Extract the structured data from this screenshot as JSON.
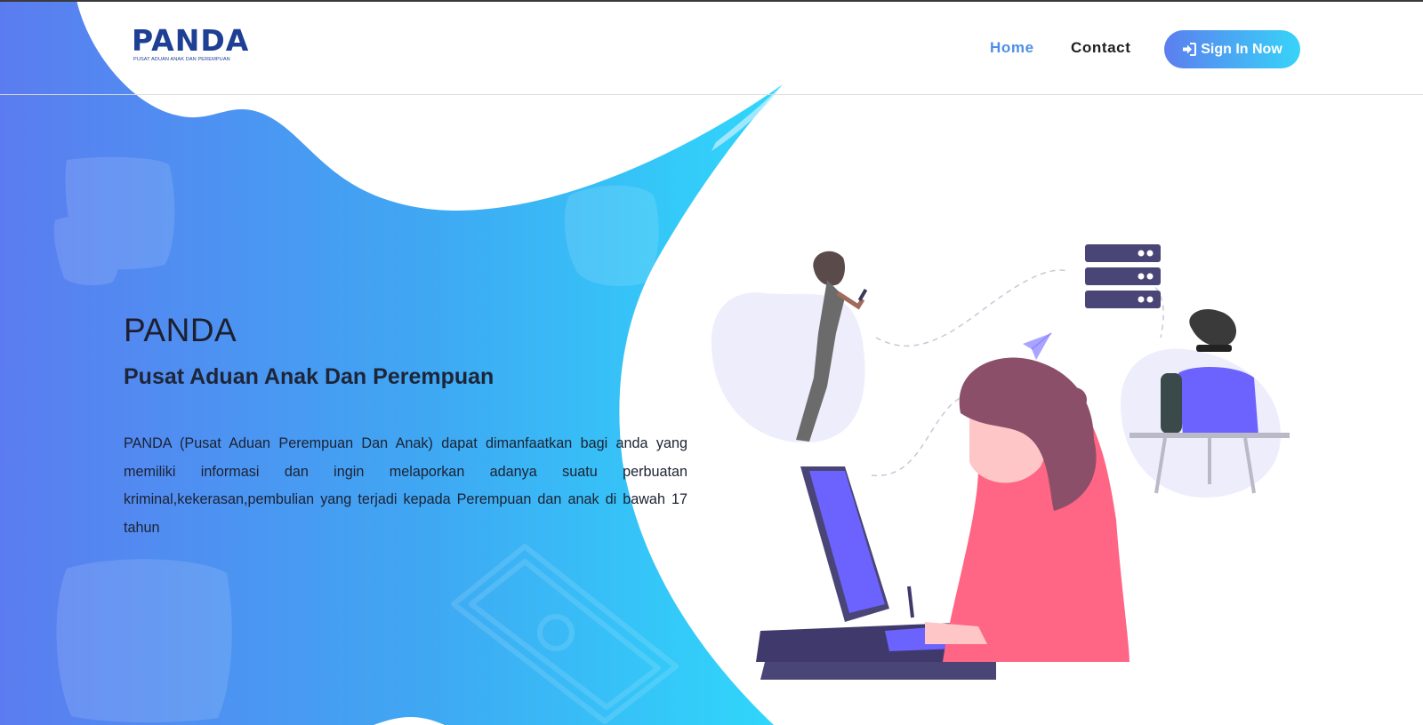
{
  "brand": {
    "name": "PANDA",
    "tagline": "PUSAT ADUAN ANAK DAN PEREMPUAN",
    "color": "#1d3f94"
  },
  "nav": {
    "items": [
      {
        "label": "Home",
        "active": true
      },
      {
        "label": "Contact",
        "active": false
      }
    ],
    "signin_label": "Sign In Now",
    "signin_icon": "sign-in-icon"
  },
  "hero": {
    "title": "PANDA",
    "subtitle": "Pusat Aduan Anak Dan Perempuan",
    "description": "PANDA (Pusat Aduan Perempuan Dan Anak) dapat dimanfaatkan bagi anda yang memiliki informasi dan ingin melaporkan adanya suatu perbuatan kriminal,kekerasan,pembulian yang terjadi kepada Perempuan dan anak di bawah 17 tahun"
  },
  "colors": {
    "gradient_start": "#5b7ff0",
    "gradient_end": "#2fd7fb",
    "accent": "#4f8ee6",
    "illustration_purple": "#6c63ff",
    "illustration_pink": "#ff6584"
  }
}
